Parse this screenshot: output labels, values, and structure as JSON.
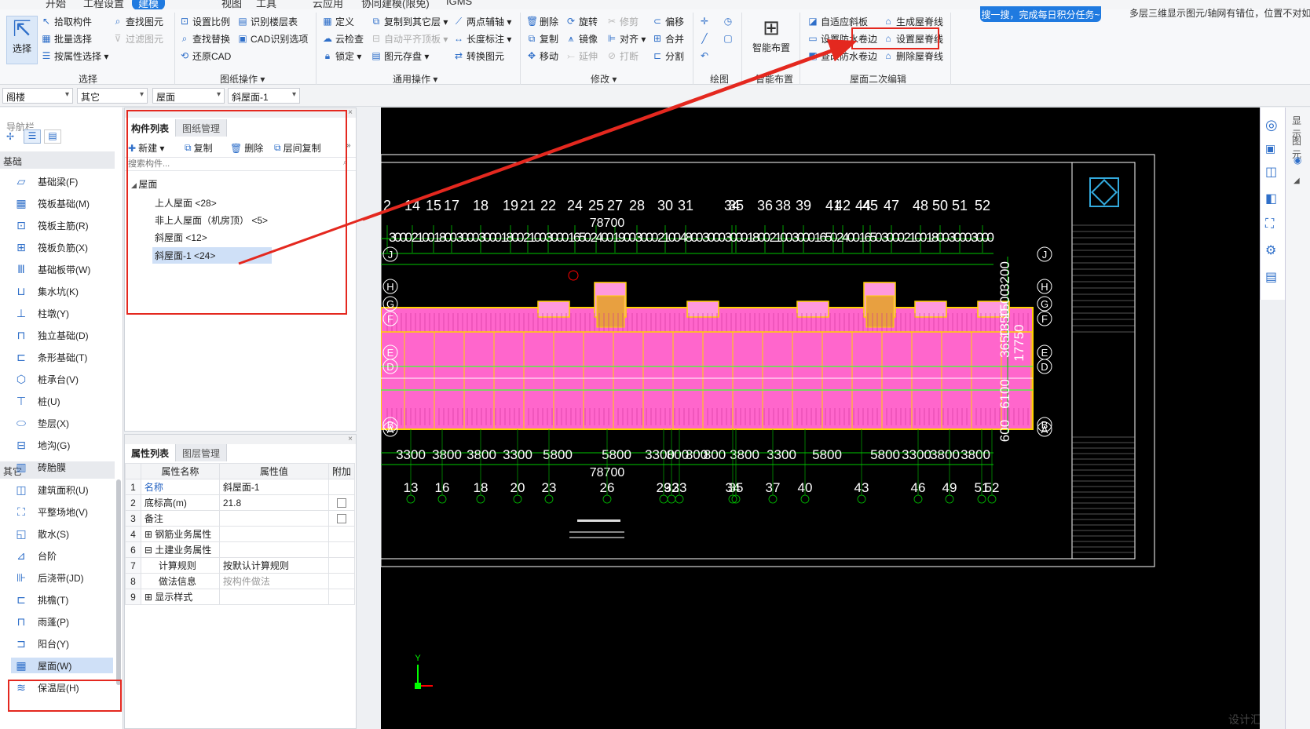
{
  "menu": {
    "tabs": [
      "开始",
      "工程设置",
      "建模",
      "视图",
      "工具",
      "云应用",
      "协同建模(限免)",
      "IGMS"
    ],
    "active": "建模",
    "banner": "搜一搜，完成每日积分任务~",
    "top_right_text": "多层三维显示图元/轴网有错位，位置不对如"
  },
  "ribbon": {
    "select_group": {
      "big_button": "选择",
      "items": [
        "拾取构件",
        "批量选择",
        "按属性选择 ▾",
        "查找图元",
        "过滤图元"
      ],
      "label": "选择"
    },
    "drawing_group": {
      "items": [
        "设置比例",
        "查找替换",
        "还原CAD",
        "识别楼层表",
        "CAD识别选项"
      ],
      "label": "图纸操作 ▾"
    },
    "common_group": {
      "items": [
        "定义",
        "云检查",
        "锁定 ▾",
        "复制到其它层 ▾",
        "自动平齐顶板 ▾",
        "图元存盘 ▾",
        "两点辅轴 ▾",
        "长度标注 ▾",
        "转换图元"
      ],
      "label": "通用操作 ▾"
    },
    "modify_group": {
      "items": [
        "删除",
        "复制",
        "移动",
        "旋转",
        "镜像",
        "延伸",
        "修剪",
        "对齐 ▾",
        "打断",
        "偏移",
        "合并",
        "分割"
      ],
      "label": "修改 ▾"
    },
    "draw_group": {
      "label": "绘图"
    },
    "smart_group": {
      "big_button": "智能布置",
      "label": "智能布置"
    },
    "roof_group": {
      "items": [
        "自适应斜板",
        "设置防水卷边",
        "查改防水卷边",
        "生成屋脊线",
        "设置屋脊线",
        "删除屋脊线"
      ],
      "label": "屋面二次编辑"
    }
  },
  "selectors": [
    "阁楼",
    "其它",
    "屋面",
    "斜屋面-1"
  ],
  "nav": {
    "title": "导航栏",
    "group_foundation": "基础",
    "foundation_items": [
      "基础梁(F)",
      "筏板基础(M)",
      "筏板主筋(R)",
      "筏板负筋(X)",
      "基础板带(W)",
      "集水坑(K)",
      "柱墩(Y)",
      "独立基础(D)",
      "条形基础(T)",
      "桩承台(V)",
      "桩(U)",
      "垫层(X)",
      "地沟(G)",
      "砖胎膜"
    ],
    "group_other": "其它",
    "other_items": [
      "建筑面积(U)",
      "平整场地(V)",
      "散水(S)",
      "台阶",
      "后浇带(JD)",
      "挑檐(T)",
      "雨蓬(P)",
      "阳台(Y)",
      "屋面(W)",
      "保温层(H)"
    ],
    "selected": "屋面(W)"
  },
  "component_panel": {
    "tabs": [
      "构件列表",
      "图纸管理"
    ],
    "toolbar": [
      "新建 ▾",
      "复制",
      "删除",
      "层间复制"
    ],
    "search_placeholder": "搜索构件...",
    "tree_root": "屋面",
    "tree_items": [
      "上人屋面 <28>",
      "非上人屋面（机房顶） <5>",
      "斜屋面 <12>",
      "斜屋面-1 <24>"
    ],
    "selected": "斜屋面-1 <24>"
  },
  "property_panel": {
    "tabs": [
      "属性列表",
      "图层管理"
    ],
    "headers": [
      "属性名称",
      "属性值",
      "附加"
    ],
    "rows": [
      {
        "n": "1",
        "name": "名称",
        "value": "斜屋面-1",
        "check": false
      },
      {
        "n": "2",
        "name": "底标高(m)",
        "value": "21.8",
        "check": true
      },
      {
        "n": "3",
        "name": "备注",
        "value": "",
        "check": true
      },
      {
        "n": "4",
        "name": "⊞ 钢筋业务属性",
        "value": "",
        "check": false
      },
      {
        "n": "6",
        "name": "⊟ 土建业务属性",
        "value": "",
        "check": false
      },
      {
        "n": "7",
        "name": "计算规则",
        "value": "按默认计算规则",
        "check": false
      },
      {
        "n": "8",
        "name": "做法信息",
        "value": "按构件做法",
        "check": false
      },
      {
        "n": "9",
        "name": "⊞ 显示样式",
        "value": "",
        "check": false
      }
    ]
  },
  "cad": {
    "top_axes": [
      "2",
      "14",
      "15",
      "17",
      "18",
      "19",
      "21",
      "22",
      "24",
      "25",
      "27",
      "28",
      "30",
      "31",
      "34",
      "35",
      "36",
      "38",
      "39",
      "41",
      "42",
      "44",
      "45",
      "47",
      "48",
      "50",
      "51",
      "52"
    ],
    "top_dims": [
      "3000",
      "2100",
      "1800",
      "3000",
      "3000",
      "1800",
      "2100",
      "3000",
      "1650",
      "2400",
      "1900",
      "3000",
      "2100",
      "4800",
      "3000",
      "3000",
      "1800",
      "2100",
      "3000",
      "1650",
      "2400",
      "1650",
      "3000",
      "2100",
      "1800",
      "3000",
      "3000"
    ],
    "total_dim": "78700",
    "bottom_axes": [
      "13",
      "16",
      "18",
      "20",
      "23",
      "26",
      "29",
      "32",
      "33",
      "34",
      "35",
      "37",
      "40",
      "43",
      "46",
      "49",
      "51",
      "52"
    ],
    "bottom_dims": [
      "3300",
      "3800",
      "3800",
      "3300",
      "5800",
      "5800",
      "3300",
      "800",
      "800",
      "800",
      "3800",
      "3300",
      "5800",
      "5800",
      "3300",
      "3800",
      "3800"
    ],
    "row_axes_left": [
      "J",
      "H",
      "G",
      "F",
      "E",
      "D",
      "B",
      "A"
    ],
    "row_axes_right": [
      "J",
      "H",
      "G",
      "F",
      "E",
      "D",
      "B",
      "A"
    ],
    "right_dims": [
      "3200",
      "1500",
      "1350",
      "3650",
      "6100",
      "600",
      "17750"
    ],
    "axis_y_label": "Y",
    "watermark": "设计汇"
  },
  "right_panel": {
    "labels": [
      "显示",
      "图元"
    ]
  }
}
